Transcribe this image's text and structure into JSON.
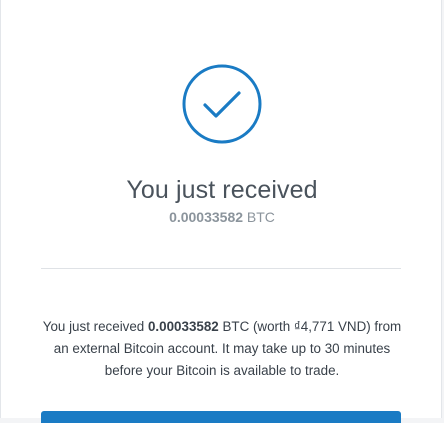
{
  "colors": {
    "accent": "#1a7bc4",
    "check_circle": "#1a7bc4",
    "divider": "#dfe2e6"
  },
  "icon": {
    "name": "checkmark-circle-icon"
  },
  "header": {
    "title": "You just received",
    "amount": "0.00033582",
    "currency": "BTC"
  },
  "message": {
    "prefix": "You just received ",
    "amount": "0.00033582",
    "suffix": " BTC (worth ₫4,771 VND) from an external Bitcoin account. It may take up to 30 minutes before your Bitcoin is available to trade."
  }
}
